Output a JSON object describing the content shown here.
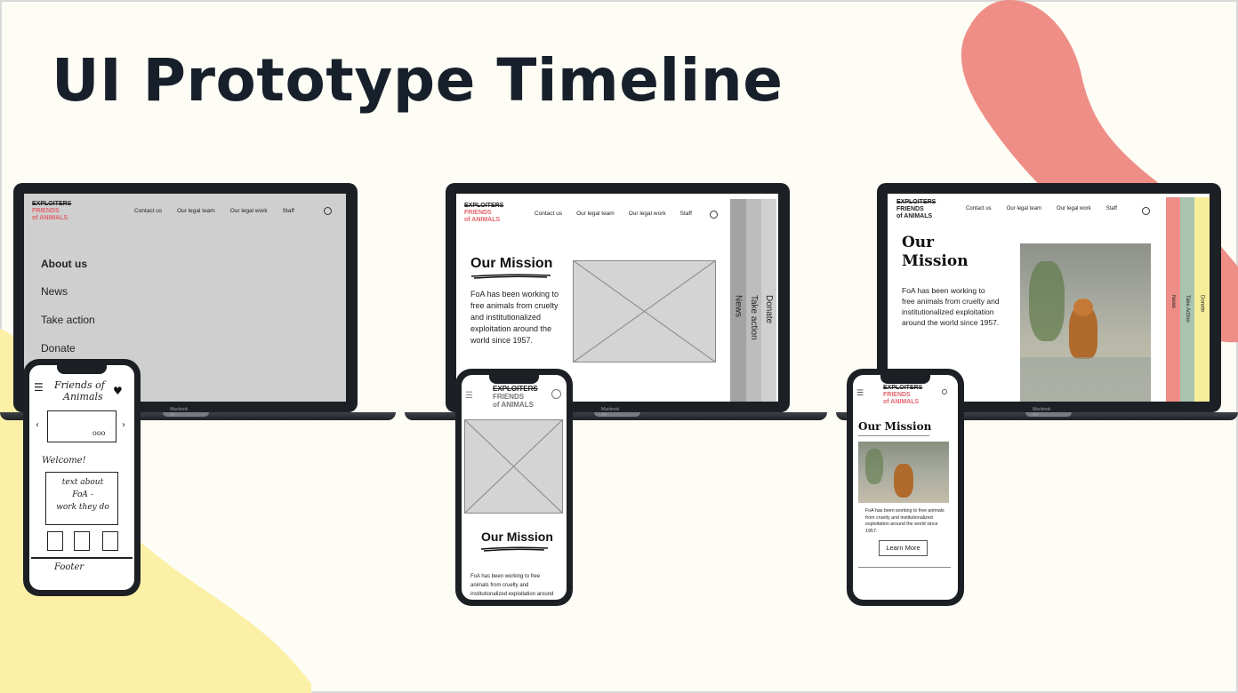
{
  "title": "UI Prototype Timeline",
  "colors": {
    "background": "#fdfdf5",
    "blob_pink": "#ee8e87",
    "blob_yellow": "#fbf0a6",
    "title": "#17202a",
    "accent_red": "#e0646b"
  },
  "laptop_label": "Macbook Air",
  "logo": {
    "strike": "EXPLOITERS",
    "line1": "FRIENDS",
    "line2": "of ANIMALS"
  },
  "nav": [
    "Contact us",
    "Our legal team",
    "Our legal work",
    "Staff"
  ],
  "laptop1": {
    "menu": [
      "About us",
      "News",
      "Take action",
      "Donate"
    ]
  },
  "laptop2": {
    "heading": "Our Mission",
    "body": "FoA has been working to free animals from cruelty and institutionalized exploitation around the world since 1957.",
    "tabs": [
      "News",
      "Take action",
      "Donate"
    ]
  },
  "laptop3": {
    "heading_line1": "Our",
    "heading_line2": "Mission",
    "body": "FoA has been working to free animals from cruelty and institutionalized exploitation around the world since 1957.",
    "tabs": [
      "News",
      "Take Action",
      "Donate"
    ]
  },
  "phone1": {
    "header_line1": "Friends of",
    "header_line2": "Animals",
    "dots": "ooo",
    "welcome": "Welcome!",
    "text_box": [
      "text about",
      "FoA -",
      "work they do"
    ],
    "footer": "Footer"
  },
  "phone2": {
    "heading": "Our Mission",
    "body": "FoA has been working to free animals from cruelty and institutionalized exploitation around the world since"
  },
  "phone3": {
    "heading": "Our Mission",
    "body": "FoA has been working to free animals from cruelty and institutionalized exploitation around the world since 1957.",
    "button": "Learn More"
  }
}
